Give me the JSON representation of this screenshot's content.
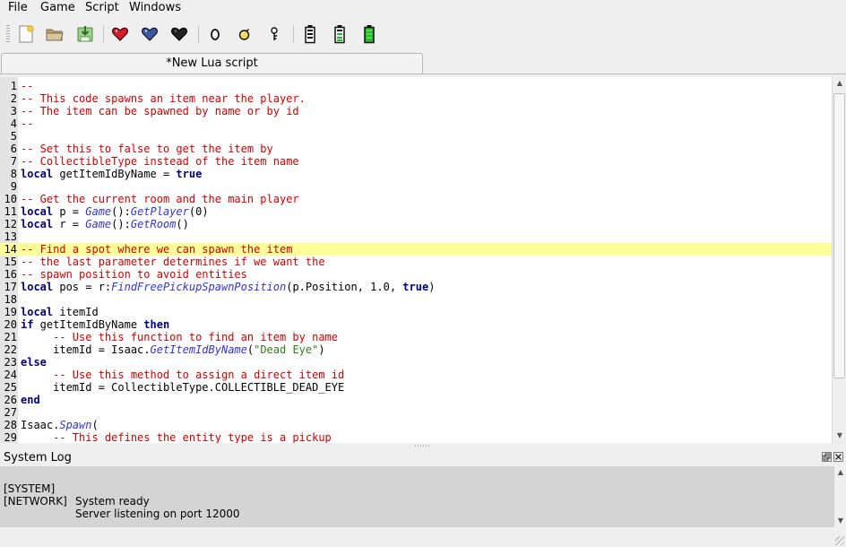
{
  "menubar": {
    "items": [
      {
        "label": "File"
      },
      {
        "label": "Game"
      },
      {
        "label": "Script"
      },
      {
        "label": "Windows"
      }
    ]
  },
  "toolbar": {
    "buttons": [
      {
        "icon": "new-file-icon"
      },
      {
        "icon": "open-folder-icon"
      },
      {
        "icon": "save-download-icon"
      },
      {
        "icon": "red-heart-icon",
        "color": "#d81b2a"
      },
      {
        "icon": "soul-heart-icon",
        "color": "#3f5a9a"
      },
      {
        "icon": "black-heart-icon",
        "color": "#222222"
      },
      {
        "icon": "penny-coin-icon"
      },
      {
        "icon": "bomb-icon"
      },
      {
        "icon": "key-icon"
      },
      {
        "icon": "battery-empty-icon"
      },
      {
        "icon": "battery-half-icon",
        "color": "#2db82d"
      },
      {
        "icon": "battery-full-icon",
        "color": "#2db82d"
      }
    ]
  },
  "tab": {
    "label": "*New Lua script"
  },
  "editor": {
    "highlighted_line": 14,
    "lines": [
      {
        "n": "1",
        "tokens": [
          {
            "t": "comment",
            "v": "--"
          }
        ]
      },
      {
        "n": "2",
        "tokens": [
          {
            "t": "comment",
            "v": "-- This code spawns an item near the player."
          }
        ]
      },
      {
        "n": "3",
        "tokens": [
          {
            "t": "comment",
            "v": "-- The item can be spawned by name or by id"
          }
        ]
      },
      {
        "n": "4",
        "tokens": [
          {
            "t": "comment",
            "v": "--"
          }
        ]
      },
      {
        "n": "5",
        "tokens": []
      },
      {
        "n": "6",
        "tokens": [
          {
            "t": "comment",
            "v": "-- Set this to false to get the item by"
          }
        ]
      },
      {
        "n": "7",
        "tokens": [
          {
            "t": "comment",
            "v": "-- CollectibleType instead of the item name"
          }
        ]
      },
      {
        "n": "8",
        "tokens": [
          {
            "t": "keyword",
            "v": "local"
          },
          {
            "t": "plain",
            "v": " getItemIdByName = "
          },
          {
            "t": "keyword",
            "v": "true"
          }
        ]
      },
      {
        "n": "9",
        "tokens": []
      },
      {
        "n": "10",
        "tokens": [
          {
            "t": "comment",
            "v": "-- Get the current room and the main player"
          }
        ]
      },
      {
        "n": "11",
        "tokens": [
          {
            "t": "keyword",
            "v": "local"
          },
          {
            "t": "plain",
            "v": " p = "
          },
          {
            "t": "func",
            "v": "Game"
          },
          {
            "t": "plain",
            "v": "():"
          },
          {
            "t": "func",
            "v": "GetPlayer"
          },
          {
            "t": "plain",
            "v": "(0)"
          }
        ]
      },
      {
        "n": "12",
        "tokens": [
          {
            "t": "keyword",
            "v": "local"
          },
          {
            "t": "plain",
            "v": " r = "
          },
          {
            "t": "func",
            "v": "Game"
          },
          {
            "t": "plain",
            "v": "():"
          },
          {
            "t": "func",
            "v": "GetRoom"
          },
          {
            "t": "plain",
            "v": "()"
          }
        ]
      },
      {
        "n": "13",
        "tokens": []
      },
      {
        "n": "14",
        "tokens": [
          {
            "t": "comment",
            "v": "-- Find a spot where we can spawn the item"
          }
        ]
      },
      {
        "n": "15",
        "tokens": [
          {
            "t": "comment",
            "v": "-- the last parameter determines if we want the"
          }
        ]
      },
      {
        "n": "16",
        "tokens": [
          {
            "t": "comment",
            "v": "-- spawn position to avoid entities"
          }
        ]
      },
      {
        "n": "17",
        "tokens": [
          {
            "t": "keyword",
            "v": "local"
          },
          {
            "t": "plain",
            "v": " pos = r:"
          },
          {
            "t": "func",
            "v": "FindFreePickupSpawnPosition"
          },
          {
            "t": "plain",
            "v": "(p.Position, 1.0, "
          },
          {
            "t": "keyword",
            "v": "true"
          },
          {
            "t": "plain",
            "v": ")"
          }
        ]
      },
      {
        "n": "18",
        "tokens": []
      },
      {
        "n": "19",
        "tokens": [
          {
            "t": "keyword",
            "v": "local"
          },
          {
            "t": "plain",
            "v": " itemId"
          }
        ]
      },
      {
        "n": "20",
        "tokens": [
          {
            "t": "keyword",
            "v": "if"
          },
          {
            "t": "plain",
            "v": " getItemIdByName "
          },
          {
            "t": "keyword",
            "v": "then"
          }
        ]
      },
      {
        "n": "21",
        "tokens": [
          {
            "t": "plain",
            "v": "     "
          },
          {
            "t": "comment",
            "v": "-- Use this function to find an item by name"
          }
        ]
      },
      {
        "n": "22",
        "tokens": [
          {
            "t": "plain",
            "v": "     itemId = Isaac."
          },
          {
            "t": "func",
            "v": "GetItemIdByName"
          },
          {
            "t": "plain",
            "v": "("
          },
          {
            "t": "string",
            "v": "\"Dead Eye\""
          },
          {
            "t": "plain",
            "v": ")"
          }
        ]
      },
      {
        "n": "23",
        "tokens": [
          {
            "t": "keyword",
            "v": "else"
          }
        ]
      },
      {
        "n": "24",
        "tokens": [
          {
            "t": "plain",
            "v": "     "
          },
          {
            "t": "comment",
            "v": "-- Use this method to assign a direct item id"
          }
        ]
      },
      {
        "n": "25",
        "tokens": [
          {
            "t": "plain",
            "v": "     itemId = CollectibleType.COLLECTIBLE_DEAD_EYE"
          }
        ]
      },
      {
        "n": "26",
        "tokens": [
          {
            "t": "keyword",
            "v": "end"
          }
        ]
      },
      {
        "n": "27",
        "tokens": []
      },
      {
        "n": "28",
        "tokens": [
          {
            "t": "plain",
            "v": "Isaac."
          },
          {
            "t": "func",
            "v": "Spawn"
          },
          {
            "t": "plain",
            "v": "("
          }
        ]
      },
      {
        "n": "29",
        "tokens": [
          {
            "t": "plain",
            "v": "     "
          },
          {
            "t": "comment",
            "v": "-- This defines the entity type is a pickup"
          }
        ]
      }
    ]
  },
  "log": {
    "title": "System Log",
    "entries": [
      {
        "tag": "[SYSTEM]",
        "message": "System ready"
      },
      {
        "tag": "[NETWORK]",
        "message": "Server listening on port 12000"
      }
    ]
  },
  "colors": {
    "comment": "#d40000",
    "keyword": "#00007f",
    "function": "#3434d6",
    "string": "#2e7d1b",
    "highlight": "#ffff99",
    "log_background": "#d4d4d4"
  }
}
